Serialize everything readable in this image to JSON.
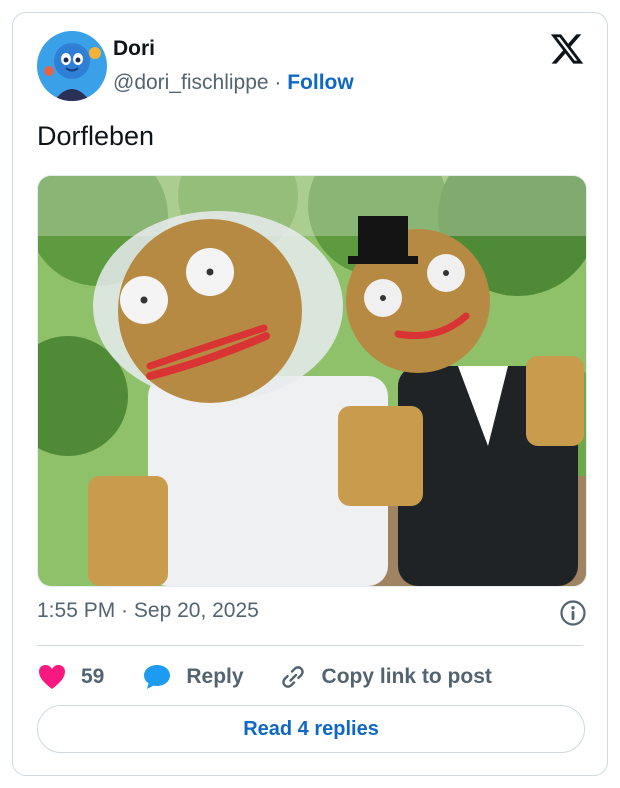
{
  "author": {
    "name": "Dori",
    "handle": "@dori_fischlippe",
    "separator": " · ",
    "follow_label": "Follow"
  },
  "tweet": {
    "text": "Dorfleben",
    "time": "1:55 PM",
    "date_separator": " · ",
    "date": "Sep 20, 2025"
  },
  "actions": {
    "like_count": "59",
    "reply_label": "Reply",
    "copy_label": "Copy link to post"
  },
  "read_replies_label": "Read 4 replies",
  "colors": {
    "like": "#f91880",
    "reply": "#1d9bf0",
    "link": "#0f68c5",
    "border": "#cfd9de"
  },
  "icons": {
    "logo": "x-logo-icon",
    "like": "heart-icon",
    "reply": "speech-bubble-icon",
    "copy": "link-icon",
    "info": "info-icon"
  }
}
